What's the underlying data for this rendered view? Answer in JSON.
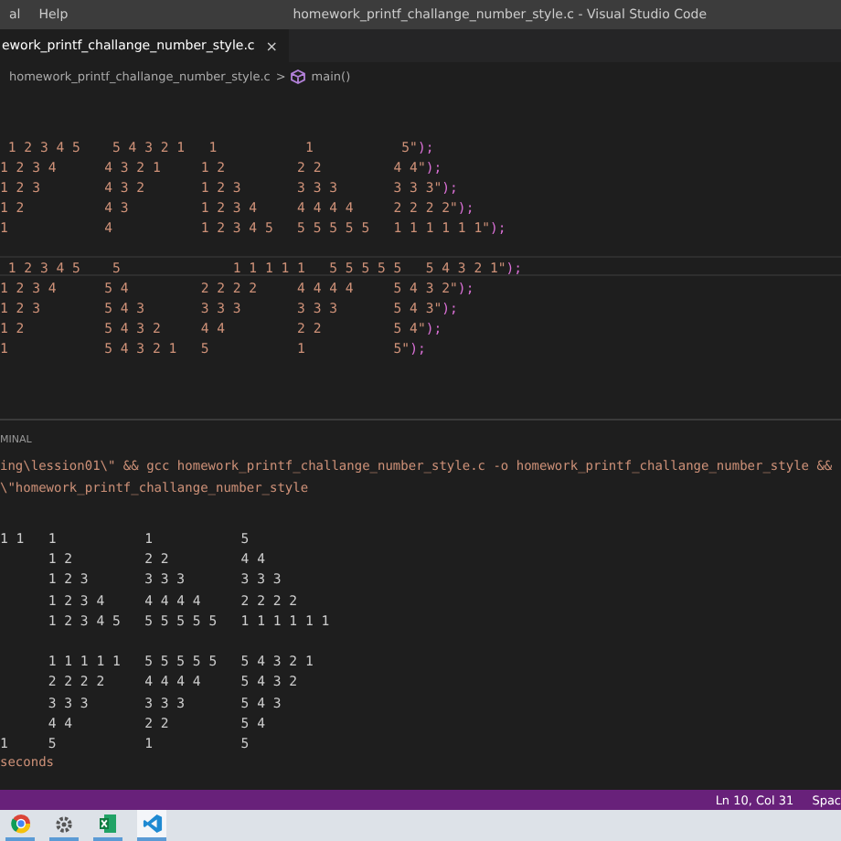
{
  "title_bar": {
    "menu": [
      "al",
      "Help"
    ],
    "title": "homework_printf_challange_number_style.c - Visual Studio Code"
  },
  "tabs": [
    {
      "label": "ework_printf_challange_number_style.c",
      "selected": true,
      "close": "×"
    }
  ],
  "breadcrumb": {
    "file": "homework_printf_challange_number_style.c",
    "separator": ">",
    "symbol": "main()"
  },
  "editor": {
    "lines": [
      {
        "text": " 1 2 3 4 5    5 4 3 2 1   1           1           5\"",
        "tail": ");",
        "cursor": false
      },
      {
        "text": "1 2 3 4      4 3 2 1     1 2         2 2         4 4\"",
        "tail": ");",
        "cursor": false
      },
      {
        "text": "1 2 3        4 3 2       1 2 3       3 3 3       3 3 3\"",
        "tail": ");",
        "cursor": false
      },
      {
        "text": "1 2          4 3         1 2 3 4     4 4 4 4     2 2 2 2\"",
        "tail": ");",
        "cursor": false
      },
      {
        "text": "1            4           1 2 3 4 5   5 5 5 5 5   1 1 1 1 1 1\"",
        "tail": ");",
        "cursor": false
      },
      {
        "cursor": false
      },
      {
        "text": " 1 2 3 4 5    5              1 1 1 1 1   5 5 5 5 5   5 4 3 2 1\"",
        "tail": ");",
        "cursor": true
      },
      {
        "text": "1 2 3 4      5 4         2 2 2 2     4 4 4 4     5 4 3 2\"",
        "tail": ");",
        "cursor": false
      },
      {
        "text": "1 2 3        5 4 3       3 3 3       3 3 3       5 4 3\"",
        "tail": ");",
        "cursor": false
      },
      {
        "text": "1 2          5 4 3 2     4 4         2 2         5 4\"",
        "tail": ");",
        "cursor": false
      },
      {
        "text": "1            5 4 3 2 1   5           1           5\"",
        "tail": ");",
        "cursor": false
      }
    ]
  },
  "terminal": {
    "label": "MINAL",
    "command": [
      "ing\\lession01\\\" && gcc homework_printf_challange_number_style.c -o homework_printf_challange_number_style &&",
      "\\\"homework_printf_challange_number_style"
    ],
    "output_groups": [
      [
        {
          "text": "1 1   1           1           5"
        },
        {
          "text": "      1 2         2 2         4 4"
        },
        {
          "text": "      1 2 3       3 3 3       3 3 3"
        },
        {
          "text": "      1 2 3 4     4 4 4 4     2 2 2 2"
        },
        {
          "text": "      1 2 3 4 5   5 5 5 5 5   1 1 1 1 1 1"
        }
      ],
      [
        {
          "text": "      1 1 1 1 1   5 5 5 5 5   5 4 3 2 1"
        },
        {
          "text": "      2 2 2 2     4 4 4 4     5 4 3 2"
        },
        {
          "text": "      3 3 3       3 3 3       5 4 3"
        },
        {
          "text": "      4 4         2 2         5 4"
        },
        {
          "text": "1     5           1           5"
        }
      ]
    ],
    "footer": "seconds"
  },
  "status_bar": {
    "position": "Ln 10, Col 31",
    "indent": "Spac"
  },
  "taskbar": [
    {
      "kind": "ring",
      "selected": false
    },
    {
      "kind": "gear",
      "selected": false
    },
    {
      "kind": "sheet",
      "selected": false
    },
    {
      "kind": "code",
      "selected": true
    }
  ]
}
